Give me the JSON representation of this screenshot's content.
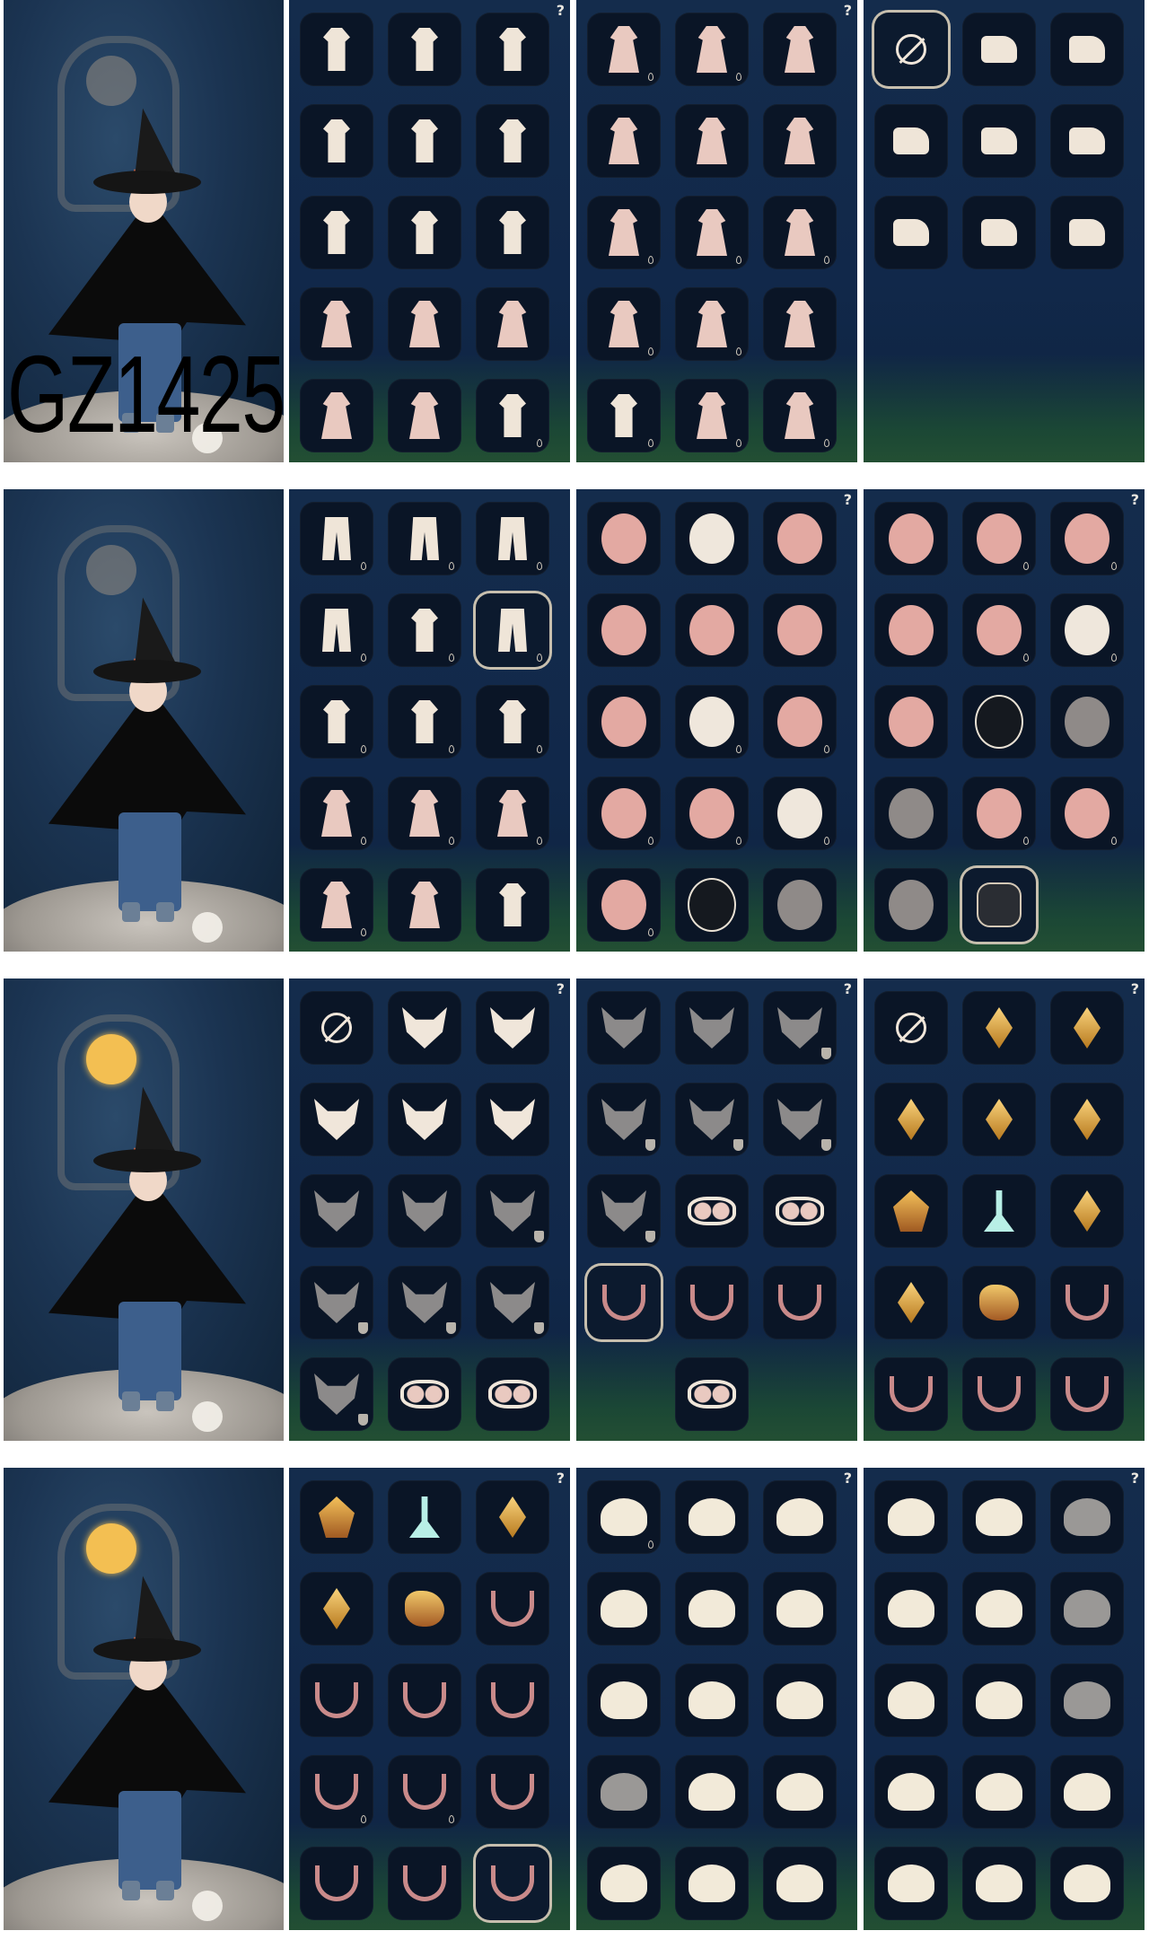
{
  "watermark": "GZ1425",
  "rows": [
    {
      "halo_lit": false,
      "panels": [
        {
          "help": "?",
          "tiles": [
            {
              "icon": "outfit-icon",
              "drop": false
            },
            {
              "icon": "outfit-icon",
              "drop": false
            },
            {
              "icon": "outfit-icon",
              "drop": false
            },
            {
              "icon": "outfit-icon",
              "drop": false
            },
            {
              "icon": "outfit-icon",
              "drop": false
            },
            {
              "icon": "outfit-icon",
              "drop": false
            },
            {
              "icon": "outfit-icon",
              "drop": false
            },
            {
              "icon": "outfit-icon",
              "drop": false
            },
            {
              "icon": "outfit-icon",
              "drop": false
            },
            {
              "icon": "robe-icon",
              "drop": false
            },
            {
              "icon": "robe-icon",
              "drop": false
            },
            {
              "icon": "robe-icon",
              "drop": false
            },
            {
              "icon": "robe-icon",
              "drop": false
            },
            {
              "icon": "robe-icon",
              "drop": false
            },
            {
              "icon": "outfit-icon",
              "drop": true
            }
          ]
        },
        {
          "help": "?",
          "tiles": [
            {
              "icon": "robe-icon",
              "drop": true
            },
            {
              "icon": "robe-icon",
              "drop": true
            },
            {
              "icon": "robe-icon",
              "drop": false
            },
            {
              "icon": "robe-icon",
              "drop": false
            },
            {
              "icon": "robe-icon",
              "drop": false
            },
            {
              "icon": "robe-icon",
              "drop": false
            },
            {
              "icon": "robe-icon",
              "drop": true
            },
            {
              "icon": "robe-icon",
              "drop": true
            },
            {
              "icon": "robe-icon",
              "drop": true
            },
            {
              "icon": "robe-icon",
              "drop": true
            },
            {
              "icon": "robe-icon",
              "drop": true
            },
            {
              "icon": "robe-icon",
              "drop": false
            },
            {
              "icon": "outfit-icon",
              "drop": true
            },
            {
              "icon": "robe-icon",
              "drop": true
            },
            {
              "icon": "robe-icon",
              "drop": true
            }
          ]
        },
        {
          "help": "",
          "tiles": [
            {
              "icon": "none-icon",
              "drop": false,
              "selected": true
            },
            {
              "icon": "shoe-icon",
              "drop": false
            },
            {
              "icon": "shoe-icon",
              "drop": false
            },
            {
              "icon": "shoe-icon",
              "drop": false
            },
            {
              "icon": "shoe-icon",
              "drop": false
            },
            {
              "icon": "shoe-icon",
              "drop": false
            },
            {
              "icon": "shoe-icon",
              "drop": false
            },
            {
              "icon": "shoe-icon",
              "drop": false
            },
            {
              "icon": "shoe-icon",
              "drop": false
            }
          ]
        }
      ]
    },
    {
      "halo_lit": false,
      "panels": [
        {
          "help": "",
          "tiles": [
            {
              "icon": "pants-icon",
              "drop": true
            },
            {
              "icon": "pants-icon",
              "drop": true
            },
            {
              "icon": "pants-icon",
              "drop": true
            },
            {
              "icon": "pants-icon",
              "drop": true
            },
            {
              "icon": "outfit-icon",
              "drop": true
            },
            {
              "icon": "pants-icon",
              "drop": true,
              "selected": true
            },
            {
              "icon": "outfit-icon",
              "drop": true
            },
            {
              "icon": "outfit-icon",
              "drop": true
            },
            {
              "icon": "outfit-icon",
              "drop": true
            },
            {
              "icon": "robe-icon",
              "drop": true
            },
            {
              "icon": "robe-icon",
              "drop": true
            },
            {
              "icon": "robe-icon",
              "drop": true
            },
            {
              "icon": "robe-icon",
              "drop": true
            },
            {
              "icon": "robe-icon",
              "drop": false
            },
            {
              "icon": "outfit-icon",
              "drop": false
            }
          ]
        },
        {
          "help": "?",
          "tiles": [
            {
              "icon": "mask-icon",
              "drop": false
            },
            {
              "icon": "mask-light-icon",
              "drop": false
            },
            {
              "icon": "mask-icon",
              "drop": false
            },
            {
              "icon": "mask-icon",
              "drop": false
            },
            {
              "icon": "mask-icon",
              "drop": false
            },
            {
              "icon": "mask-icon",
              "drop": false
            },
            {
              "icon": "mask-icon",
              "drop": false
            },
            {
              "icon": "mask-light-icon",
              "drop": true
            },
            {
              "icon": "mask-icon",
              "drop": true
            },
            {
              "icon": "mask-icon",
              "drop": true
            },
            {
              "icon": "mask-icon",
              "drop": true
            },
            {
              "icon": "mask-light-icon",
              "drop": true
            },
            {
              "icon": "mask-icon",
              "drop": true
            },
            {
              "icon": "mask-dark-icon",
              "drop": false
            },
            {
              "icon": "mask-gray-icon",
              "drop": false
            }
          ]
        },
        {
          "help": "?",
          "tiles": [
            {
              "icon": "mask-icon",
              "drop": false
            },
            {
              "icon": "mask-icon",
              "drop": true
            },
            {
              "icon": "mask-icon",
              "drop": true
            },
            {
              "icon": "mask-icon",
              "drop": false
            },
            {
              "icon": "mask-icon",
              "drop": true
            },
            {
              "icon": "mask-light-icon",
              "drop": true
            },
            {
              "icon": "mask-icon",
              "drop": false
            },
            {
              "icon": "mask-dark-icon",
              "drop": false
            },
            {
              "icon": "mask-gray-icon",
              "drop": false
            },
            {
              "icon": "mask-gray-icon",
              "drop": false
            },
            {
              "icon": "mask-icon",
              "drop": true
            },
            {
              "icon": "mask-icon",
              "drop": true
            },
            {
              "icon": "mask-gray-icon",
              "drop": false
            },
            {
              "icon": "crest-icon",
              "drop": false,
              "selected": true
            }
          ]
        }
      ]
    },
    {
      "halo_lit": true,
      "panels": [
        {
          "help": "?",
          "tiles": [
            {
              "icon": "none-icon",
              "drop": false
            },
            {
              "icon": "horn-icon",
              "drop": false
            },
            {
              "icon": "horn-icon",
              "drop": false
            },
            {
              "icon": "horn-icon",
              "drop": false
            },
            {
              "icon": "horn-icon",
              "drop": false
            },
            {
              "icon": "horn-icon",
              "drop": false
            },
            {
              "icon": "horn-dim-icon",
              "drop": false
            },
            {
              "icon": "horn-dim-icon",
              "drop": false
            },
            {
              "icon": "horn-dim-icon",
              "badge": true
            },
            {
              "icon": "horn-dim-icon",
              "badge": true
            },
            {
              "icon": "horn-dim-icon",
              "badge": true
            },
            {
              "icon": "horn-dim-icon",
              "badge": true
            },
            {
              "icon": "horn-dim-icon",
              "badge": true
            },
            {
              "icon": "glasses-icon",
              "drop": false
            },
            {
              "icon": "glasses-icon",
              "drop": false
            }
          ]
        },
        {
          "help": "?",
          "tiles": [
            {
              "icon": "horn-dim-icon",
              "drop": false
            },
            {
              "icon": "horn-dim-icon",
              "drop": false
            },
            {
              "icon": "horn-dim-icon",
              "badge": true
            },
            {
              "icon": "horn-dim-icon",
              "badge": true
            },
            {
              "icon": "horn-dim-icon",
              "badge": true
            },
            {
              "icon": "horn-dim-icon",
              "badge": true
            },
            {
              "icon": "horn-dim-icon",
              "badge": true
            },
            {
              "icon": "glasses-icon",
              "drop": false
            },
            {
              "icon": "glasses-icon",
              "drop": false
            },
            {
              "icon": "neck-icon",
              "drop": false,
              "selected": true
            },
            {
              "icon": "neck-icon",
              "drop": false
            },
            {
              "icon": "neck-icon",
              "drop": false
            },
            {
              "icon": "empty",
              "drop": false
            },
            {
              "icon": "glasses-icon",
              "drop": false
            }
          ]
        },
        {
          "help": "?",
          "tiles": [
            {
              "icon": "none-icon",
              "drop": false
            },
            {
              "icon": "gold-icon",
              "drop": false
            },
            {
              "icon": "gold-icon",
              "drop": false
            },
            {
              "icon": "gold-icon",
              "drop": false
            },
            {
              "icon": "gold-icon",
              "drop": false
            },
            {
              "icon": "gold-icon",
              "drop": false
            },
            {
              "icon": "seal-icon",
              "drop": false
            },
            {
              "icon": "teal-icon",
              "drop": false
            },
            {
              "icon": "gold-icon",
              "drop": false
            },
            {
              "icon": "gold-icon",
              "drop": false
            },
            {
              "icon": "bird-icon",
              "drop": false
            },
            {
              "icon": "neck-icon",
              "drop": false
            },
            {
              "icon": "neck-icon",
              "drop": false
            },
            {
              "icon": "neck-icon",
              "drop": false
            },
            {
              "icon": "neck-icon",
              "drop": false
            }
          ]
        }
      ]
    },
    {
      "halo_lit": true,
      "panels": [
        {
          "help": "?",
          "tiles": [
            {
              "icon": "seal-icon",
              "drop": false
            },
            {
              "icon": "teal-icon",
              "drop": false
            },
            {
              "icon": "gold-icon",
              "drop": false
            },
            {
              "icon": "gold-icon",
              "drop": false
            },
            {
              "icon": "bird-icon",
              "drop": false
            },
            {
              "icon": "neck-icon",
              "drop": false
            },
            {
              "icon": "neck-icon",
              "drop": false
            },
            {
              "icon": "neck-icon",
              "drop": false
            },
            {
              "icon": "neck-icon",
              "drop": false
            },
            {
              "icon": "neck-icon",
              "drop": true
            },
            {
              "icon": "neck-icon",
              "drop": true
            },
            {
              "icon": "neck-icon",
              "drop": false
            },
            {
              "icon": "neck-icon",
              "drop": false
            },
            {
              "icon": "neck-icon",
              "drop": false
            },
            {
              "icon": "neck-icon",
              "drop": false,
              "selected": true
            }
          ]
        },
        {
          "help": "?",
          "tiles": [
            {
              "icon": "hair-icon",
              "drop": true
            },
            {
              "icon": "hair-icon",
              "drop": false
            },
            {
              "icon": "hair-icon",
              "drop": false
            },
            {
              "icon": "hair-icon",
              "drop": false
            },
            {
              "icon": "hair-icon",
              "drop": false
            },
            {
              "icon": "hair-icon",
              "drop": false
            },
            {
              "icon": "hair-icon",
              "drop": false
            },
            {
              "icon": "hair-icon",
              "drop": false
            },
            {
              "icon": "hair-icon",
              "drop": false
            },
            {
              "icon": "hair-dim-icon",
              "drop": false
            },
            {
              "icon": "hair-icon",
              "drop": false
            },
            {
              "icon": "hair-icon",
              "drop": false
            },
            {
              "icon": "hair-icon",
              "drop": false
            },
            {
              "icon": "hair-icon",
              "drop": false
            },
            {
              "icon": "hair-icon",
              "drop": false
            }
          ]
        },
        {
          "help": "?",
          "tiles": [
            {
              "icon": "hair-icon",
              "drop": false
            },
            {
              "icon": "hair-icon",
              "drop": false
            },
            {
              "icon": "hair-dim-icon",
              "drop": false
            },
            {
              "icon": "hair-icon",
              "drop": false
            },
            {
              "icon": "hair-icon",
              "drop": false
            },
            {
              "icon": "hair-dim-icon",
              "drop": false
            },
            {
              "icon": "hair-icon",
              "drop": false
            },
            {
              "icon": "hair-icon",
              "drop": false
            },
            {
              "icon": "hair-dim-icon",
              "drop": false
            },
            {
              "icon": "hair-icon",
              "drop": false
            },
            {
              "icon": "hair-icon",
              "drop": false
            },
            {
              "icon": "hair-icon",
              "drop": false
            },
            {
              "icon": "hair-icon",
              "drop": false
            },
            {
              "icon": "hair-icon",
              "drop": false
            },
            {
              "icon": "hair-icon",
              "drop": false
            }
          ]
        }
      ]
    }
  ]
}
